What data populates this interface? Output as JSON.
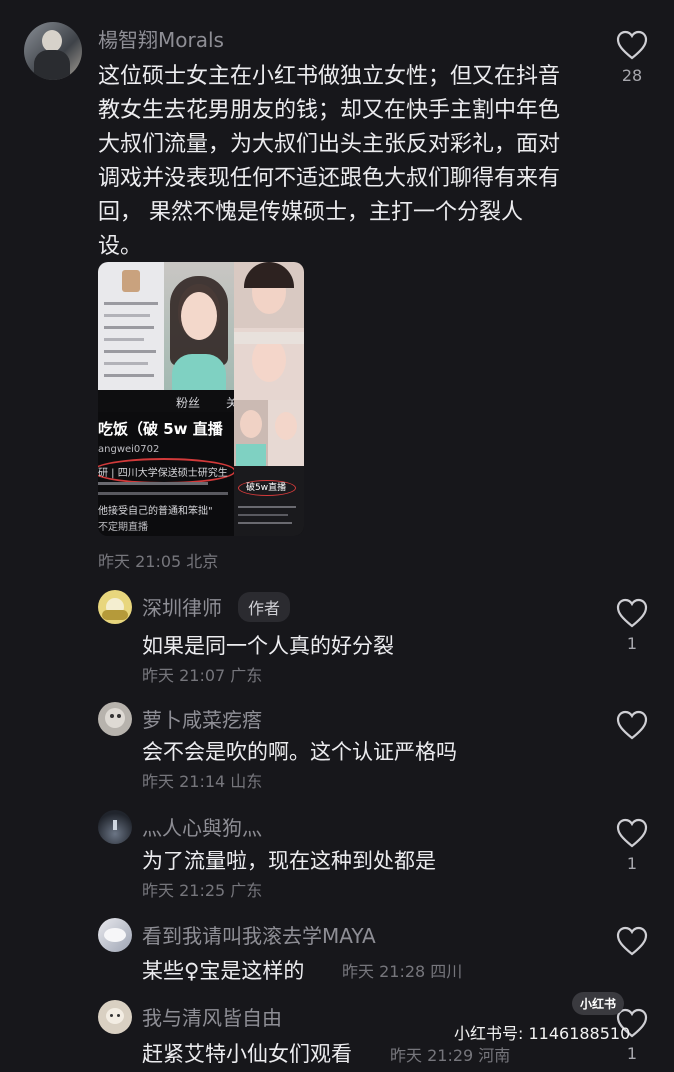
{
  "post": {
    "author": "楊智翔Morals",
    "text": "这位硕士女主在小红书做独立女性；但又在抖音教女生去花男朋友的钱；却又在快手主割中年色大叔们流量，为大叔们出头主张反对彩礼，面对调戏并没表现任何不适还跟色大叔们聊得有来有回， 果然不愧是传媒硕士，主打一个分裂人设。",
    "time": "昨天 21:05 北京",
    "likes": "28",
    "image_text": {
      "fans": "粉丝",
      "guan": "关",
      "banner": "吃饭（破 5w 直播",
      "handle": "angwei0702",
      "line1": "研 | 四川大学保送硕士研究生",
      "line2": "他接受自己的普通和笨拙\"",
      "line3": "不定期直播",
      "small_banner": "破5w直播"
    }
  },
  "comments": [
    {
      "name": "深圳律师",
      "badge": "作者",
      "text": "如果是同一个人真的好分裂",
      "meta": "昨天 21:07 广东",
      "likes": "1"
    },
    {
      "name": "萝卜咸菜疙瘩",
      "text": "会不会是吹的啊。这个认证严格吗",
      "meta": "昨天 21:14 山东",
      "likes": ""
    },
    {
      "name": "灬人心與狗灬",
      "text": "为了流量啦，现在这种到处都是",
      "meta": "昨天 21:25 广东",
      "likes": "1"
    },
    {
      "name": "看到我请叫我滚去学MAYA",
      "text": "某些♀宝是这样的",
      "meta": "昨天 21:28 四川",
      "likes": ""
    },
    {
      "name": "我与清风皆自由",
      "text": "赶紧艾特小仙女们观看",
      "meta": "昨天 21:29 河南",
      "likes": "1"
    }
  ],
  "watermark": {
    "logo": "小红书",
    "id_text": "小红书号: 1146188510"
  },
  "icons": {
    "like": "heart-outline-icon"
  }
}
